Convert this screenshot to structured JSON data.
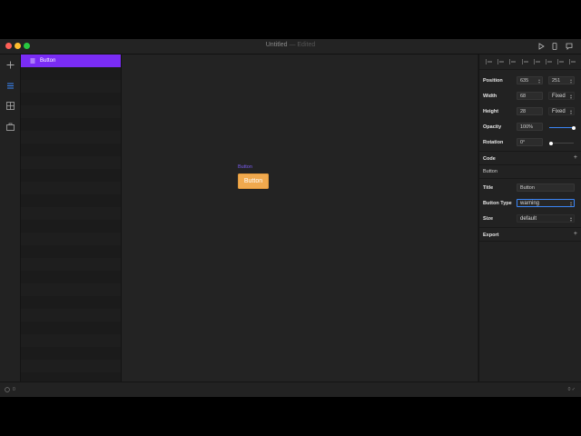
{
  "window": {
    "title": "Untitled",
    "edited": "— Edited",
    "controls": [
      "close",
      "minimize",
      "zoom"
    ],
    "colors": {
      "close": "#fe5f57",
      "minimize": "#febc2e",
      "zoom": "#28c840"
    }
  },
  "toolbar": {
    "icons": [
      "play-icon",
      "phone-icon",
      "comment-icon"
    ]
  },
  "leftbar": {
    "icons": [
      "plus-icon",
      "layers-icon",
      "grid-icon",
      "briefcase-icon"
    ]
  },
  "layers": {
    "items": [
      {
        "label": "Button",
        "icon": "list-icon"
      }
    ]
  },
  "canvas": {
    "component_label": "Button",
    "button_text": "Button",
    "button_color": "#f0a94e"
  },
  "inspector": {
    "position": {
      "label": "Position",
      "x": "635",
      "y": "251"
    },
    "width": {
      "label": "Width",
      "value": "68",
      "mode": "Fixed"
    },
    "height": {
      "label": "Height",
      "value": "28",
      "mode": "Fixed"
    },
    "opacity": {
      "label": "Opacity",
      "value": "100%",
      "level": 1.0
    },
    "rotation": {
      "label": "Rotation",
      "value": "0°",
      "level": 0.0
    },
    "code": {
      "label": "Code",
      "component": "Button"
    },
    "props": {
      "title_label": "Title",
      "title_value": "Button",
      "type_label": "Button Type",
      "type_value": "warning",
      "size_label": "Size",
      "size_value": "default"
    },
    "export": {
      "label": "Export"
    },
    "accent": "#3b86f7"
  },
  "statusbar": {
    "left": "0",
    "right": "0"
  }
}
